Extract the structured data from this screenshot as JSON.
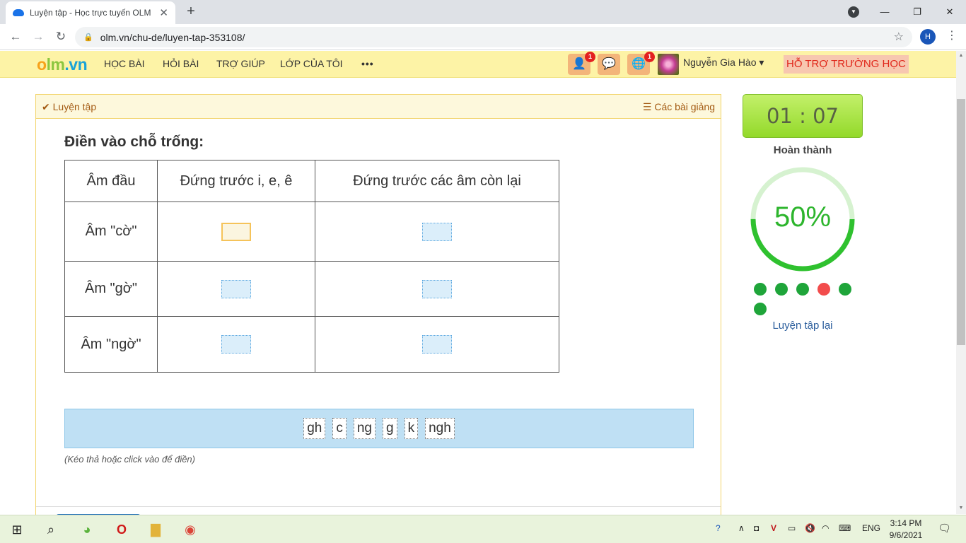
{
  "browser": {
    "tab_title": "Luyện tập - Học trực tuyến OLM",
    "url": "olm.vn/chu-de/luyen-tap-353108/",
    "profile_initial": "H"
  },
  "site": {
    "logo": {
      "p1": "o",
      "p2": "lm",
      "p3": ".vn"
    },
    "nav": [
      "HỌC BÀI",
      "HỎI BÀI",
      "TRỢ GIÚP",
      "LỚP CỦA TÔI",
      "•••"
    ],
    "friend_requests_badge": "1",
    "world_badge": "1",
    "user_name": "Nguyễn Gia Hào",
    "support_label": "HỖ TRỢ TRƯỜNG HỌC"
  },
  "panel": {
    "header_left": "Luyện tập",
    "header_right": "Các bài giảng",
    "question": "Điền vào chỗ trống:",
    "table": {
      "headers": [
        "Âm đầu",
        "Đứng trước i, e, ê",
        "Đứng trước các âm còn lại"
      ],
      "rows": [
        "Âm \"cờ\"",
        "Âm \"gờ\"",
        "Âm \"ngờ\""
      ]
    },
    "choices": [
      "gh",
      "c",
      "ng",
      "g",
      "k",
      "ngh"
    ],
    "hint": "(Kéo thả hoặc click vào để điền)"
  },
  "sidebar": {
    "timer": "01 : 07",
    "status": "Hoàn thành",
    "progress_percent": 50,
    "progress_label": "50%",
    "results": [
      "correct",
      "correct",
      "correct",
      "wrong",
      "correct",
      "correct"
    ],
    "retry_label": "Luyện tập lại",
    "colors": {
      "correct": "#1fa53a",
      "wrong": "#f24c4c",
      "ring": "#2fc12f",
      "ring_track": "#d6f2d0"
    }
  },
  "taskbar": {
    "language": "ENG",
    "time": "3:14 PM",
    "date": "9/6/2021"
  }
}
